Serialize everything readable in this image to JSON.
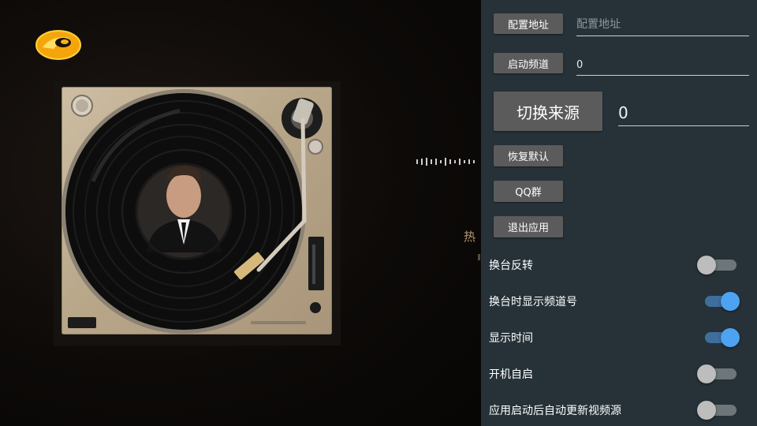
{
  "background": {
    "logo": "mango-tv-logo",
    "overlay_text": "热"
  },
  "settings": {
    "config_address_button": "配置地址",
    "config_address_placeholder": "配置地址",
    "start_channel_button": "启动频道",
    "start_channel_value": "0",
    "switch_source_button": "切换来源",
    "switch_source_value": "0",
    "restore_defaults_button": "恢复默认",
    "qq_group_button": "QQ群",
    "exit_app_button": "退出应用",
    "toggles": [
      {
        "label": "换台反转",
        "on": false
      },
      {
        "label": "换台时显示频道号",
        "on": true
      },
      {
        "label": "显示时间",
        "on": true
      },
      {
        "label": "开机自启",
        "on": false
      },
      {
        "label": "应用启动后自动更新视频源",
        "on": false
      }
    ]
  },
  "colors": {
    "panel_bg": "#263238",
    "button_bg": "#5b5b5b",
    "switch_on": "#4da3f1",
    "switch_off": "#bdbdbd"
  }
}
